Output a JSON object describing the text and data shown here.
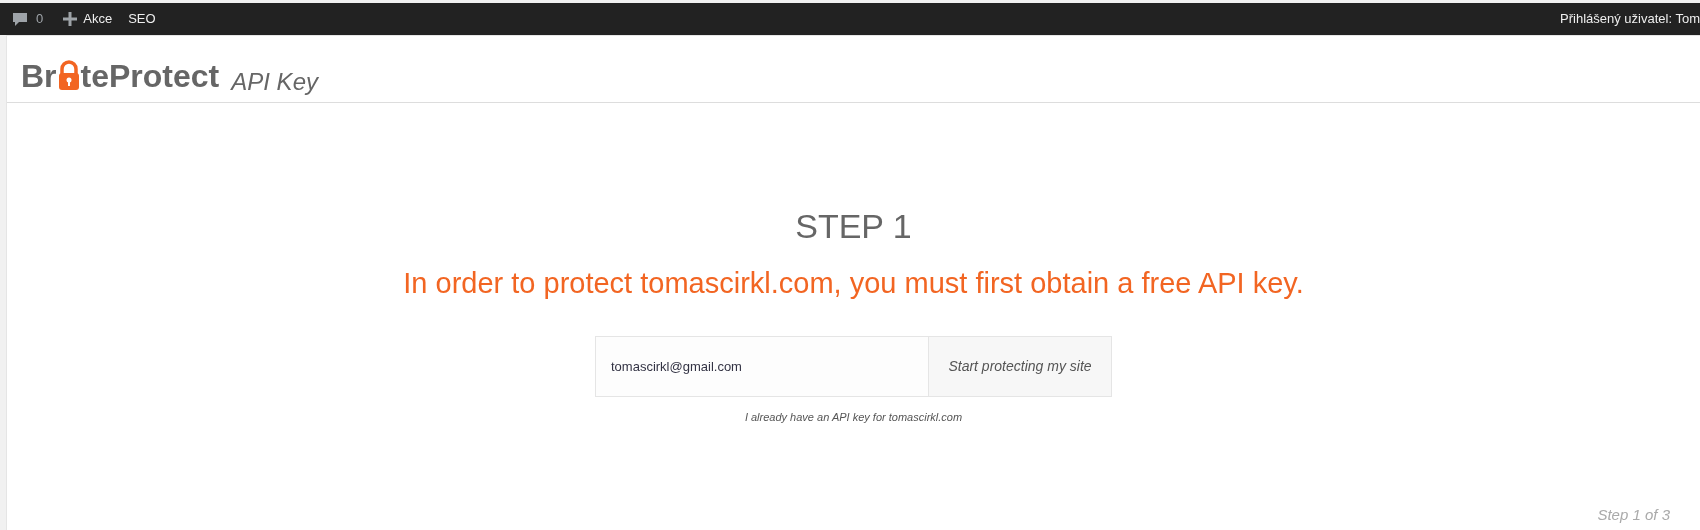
{
  "admin_bar": {
    "comments_count": "0",
    "new_label": "Akce",
    "seo_label": "SEO",
    "user_greeting": "Přihlášený uživatel: Tom"
  },
  "header": {
    "logo_parts": [
      "Br",
      "teProtect"
    ],
    "subtitle": "API Key"
  },
  "step": {
    "heading": "STEP 1",
    "message": "In order to protect tomascirkl.com, you must first obtain a free API key."
  },
  "form": {
    "email_value": "tomascirkl@gmail.com",
    "submit_label": "Start protecting my site",
    "link": "I already have an API key for tomascirkl.com"
  },
  "footer": {
    "progress": "Step 1 of 3"
  }
}
